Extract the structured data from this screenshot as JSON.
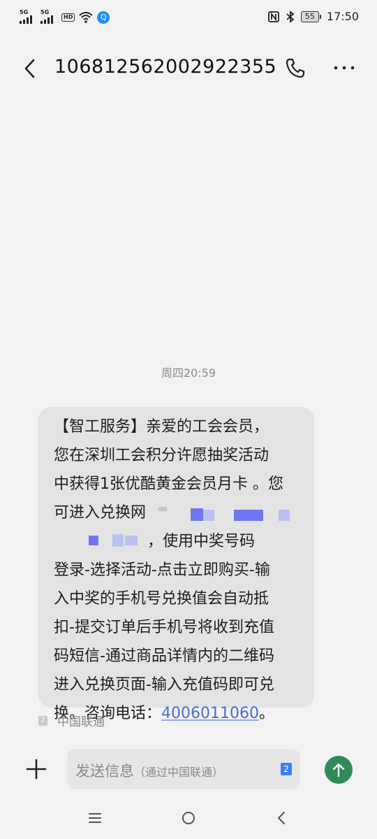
{
  "status_bar": {
    "net1": "5G",
    "net2": "5G",
    "hd_label": "HD",
    "battery": "55",
    "time": "17:50",
    "app_icon": "Q"
  },
  "header": {
    "title": "106812562002922355"
  },
  "timestamp": "周四20:59",
  "message": {
    "line1": "【智工服务】亲爱的工会会员，",
    "line2": "您在深圳工会积分许愿抽奖活动",
    "line3": "中获得1张优酷黄金会员月卡 。您",
    "line4": "可进入兑换网",
    "line5_text": "，使用中奖号码",
    "line6": "登录-选择活动-点击立即购买-输",
    "line7": "入中奖的手机号兑换值会自动抵",
    "line8": "扣-提交订单后手机号将收到充值",
    "line9": "码短信-通过商品详情内的二维码",
    "line10": "进入兑换页面-输入充值码即可兑",
    "line11_prefix": "换。咨询电话：",
    "phone": "4006011060",
    "line11_suffix": "。"
  },
  "sim": {
    "badge": "2",
    "carrier": "中国联通"
  },
  "composer": {
    "placeholder_main": "发送信息",
    "placeholder_sub": "（通过中国联通）",
    "sim_badge": "2"
  },
  "colors": {
    "background": "#f2f2f2",
    "bubble": "#e3e3e3",
    "link": "#4b6dd4",
    "send": "#2e8b57"
  }
}
